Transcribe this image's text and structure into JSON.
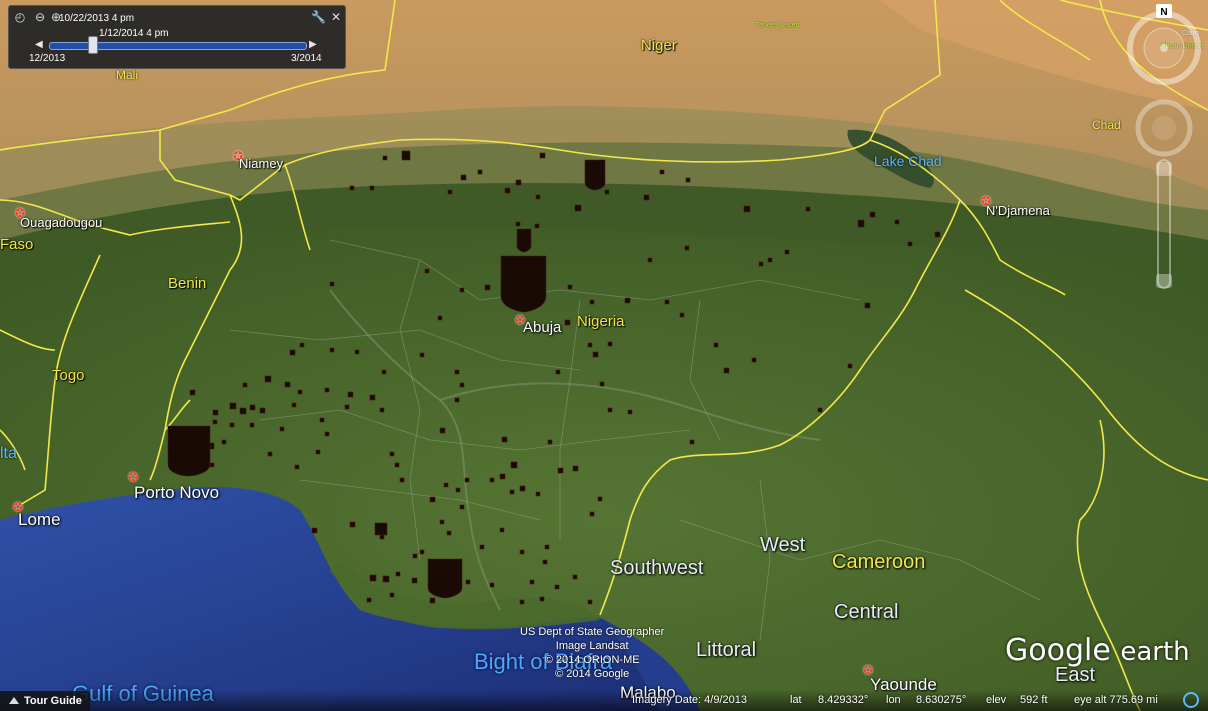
{
  "time_slider": {
    "current_start": "10/22/2013   4 pm",
    "current_end": "1/12/2014   4 pm",
    "range_start": "12/2013",
    "range_end": "3/2014",
    "position_fraction": 0.17
  },
  "labels": {
    "countries": [
      {
        "id": "niger",
        "text": "Niger"
      },
      {
        "id": "mali",
        "text": "Mali"
      },
      {
        "id": "chad",
        "text": "Chad"
      },
      {
        "id": "benin",
        "text": "Benin"
      },
      {
        "id": "togo",
        "text": "Togo"
      },
      {
        "id": "nigeria",
        "text": "Nigeria"
      },
      {
        "id": "cameroon",
        "text": "Cameroon"
      },
      {
        "id": "faso",
        "text": "Faso"
      },
      {
        "id": "volta",
        "text": "lta"
      }
    ],
    "cities": [
      {
        "id": "niamey",
        "text": "Niamey"
      },
      {
        "id": "ouagadougou",
        "text": "Ouagadougou"
      },
      {
        "id": "ndjamena",
        "text": "N'Djamena"
      },
      {
        "id": "abuja",
        "text": "Abuja"
      },
      {
        "id": "porto-novo",
        "text": "Porto Novo"
      },
      {
        "id": "lome",
        "text": "Lome"
      },
      {
        "id": "yaounde",
        "text": "Yaounde"
      },
      {
        "id": "malabo",
        "text": "Malabo"
      },
      {
        "id": "tenere",
        "text": "Ténéré Desert"
      },
      {
        "id": "libyan-desert",
        "text": "Libyan Desert"
      },
      {
        "id": "cairo",
        "text": "Cairo"
      }
    ],
    "regions": [
      {
        "id": "southwest",
        "text": "Southwest"
      },
      {
        "id": "west",
        "text": "West"
      },
      {
        "id": "central",
        "text": "Central"
      },
      {
        "id": "littoral",
        "text": "Littoral"
      },
      {
        "id": "east",
        "text": "East"
      }
    ],
    "water": [
      {
        "id": "lake-chad",
        "text": "Lake Chad"
      },
      {
        "id": "bight",
        "text": "Bight of Biafra"
      },
      {
        "id": "gulf",
        "text": "Gulf of Guinea"
      }
    ]
  },
  "credits": {
    "line1": "US Dept of State Geographer",
    "line2": "Image Landsat",
    "line3": "© 2014 ORION-ME",
    "line4": "© 2014 Google"
  },
  "logo": {
    "brand": "Google",
    "product": "earth"
  },
  "status": {
    "tour_guide": "Tour Guide",
    "imagery_date": "Imagery Date: 4/9/2013",
    "lat_label": "lat",
    "lat_value": "8.429332°",
    "lon_label": "lon",
    "lon_value": "8.630275°",
    "elev_label": "elev",
    "elev_value": "592 ft",
    "eye_alt": "eye alt 775.69 mi"
  },
  "compass": {
    "north_label": "N"
  },
  "colors": {
    "border": "#f2e84a",
    "country_label": "#f2e84a",
    "city_star": "#ff3b2a",
    "water_label": "#4aa8ff",
    "event_marker": "#1a0a05"
  }
}
